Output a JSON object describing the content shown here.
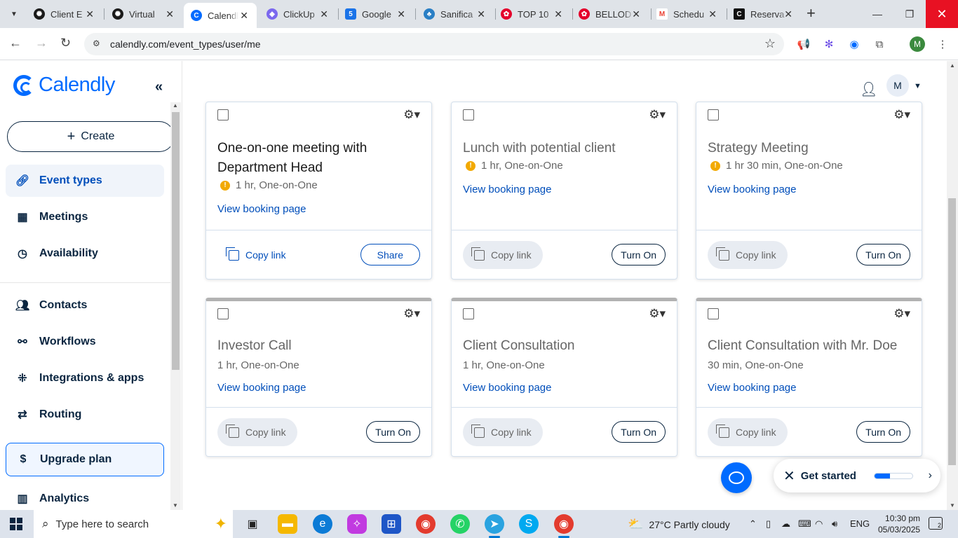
{
  "browser": {
    "tabs": [
      {
        "title": "Client E",
        "fav_color": "#1a1a1a"
      },
      {
        "title": "Virtual",
        "fav_color": "#1a1a1a"
      },
      {
        "title": "Calendly",
        "fav_color": "#006bff"
      },
      {
        "title": "ClickUp",
        "fav_color": "#7b68ee"
      },
      {
        "title": "Google",
        "fav_color": "#1a73e8"
      },
      {
        "title": "Sanifica",
        "fav_color": "#2a7fc5"
      },
      {
        "title": "TOP 10",
        "fav_color": "#e4002b"
      },
      {
        "title": "BELLOD",
        "fav_color": "#e4002b"
      },
      {
        "title": "Schedu",
        "fav_color": "#ea4335"
      },
      {
        "title": "Reserva",
        "fav_color": "#111111"
      }
    ],
    "url": "calendly.com/event_types/user/me",
    "profile_initial": "M"
  },
  "sidebar": {
    "logo_text": "Calendly",
    "create_label": "Create",
    "items": [
      {
        "label": "Event types",
        "icon": "link-icon"
      },
      {
        "label": "Meetings",
        "icon": "calendar-icon"
      },
      {
        "label": "Availability",
        "icon": "clock-icon"
      },
      {
        "label": "Contacts",
        "icon": "contacts-icon"
      },
      {
        "label": "Workflows",
        "icon": "workflow-icon"
      },
      {
        "label": "Integrations & apps",
        "icon": "apps-grid-icon"
      },
      {
        "label": "Routing",
        "icon": "routing-icon"
      },
      {
        "label": "Upgrade plan",
        "icon": "dollar-icon"
      },
      {
        "label": "Analytics",
        "icon": "analytics-icon"
      }
    ]
  },
  "header": {
    "avatar_initial": "M"
  },
  "cards": [
    {
      "title": "One-on-one meeting with Department Head",
      "meta": "1 hr, One-on-One",
      "warning": true,
      "link": "View booking page",
      "copy_label": "Copy link",
      "button_label": "Share",
      "enabled": true
    },
    {
      "title": "Lunch with potential client",
      "meta": "1 hr, One-on-One",
      "warning": true,
      "link": "View booking page",
      "copy_label": "Copy link",
      "button_label": "Turn On",
      "enabled": false
    },
    {
      "title": "Strategy Meeting",
      "meta": "1 hr 30 min, One-on-One",
      "warning": true,
      "link": "View booking page",
      "copy_label": "Copy link",
      "button_label": "Turn On",
      "enabled": false
    },
    {
      "title": "Investor Call",
      "meta": "1 hr, One-on-One",
      "warning": false,
      "link": "View booking page",
      "copy_label": "Copy link",
      "button_label": "Turn On",
      "enabled": false
    },
    {
      "title": "Client Consultation",
      "meta": "1 hr, One-on-One",
      "warning": false,
      "link": "View booking page",
      "copy_label": "Copy link",
      "button_label": "Turn On",
      "enabled": false
    },
    {
      "title": "Client Consultation with Mr. Doe",
      "meta": "30 min, One-on-One",
      "warning": false,
      "link": "View booking page",
      "copy_label": "Copy link",
      "button_label": "Turn On",
      "enabled": false
    }
  ],
  "get_started": {
    "label": "Get started",
    "progress": 0.4
  },
  "taskbar": {
    "search_placeholder": "Type here to search",
    "weather": "27°C  Partly cloudy",
    "language": "ENG",
    "time": "10:30 pm",
    "date": "05/03/2025",
    "notif_count": "2"
  },
  "colors": {
    "brand": "#006bff",
    "link": "#004eba",
    "navy": "#0a2540"
  }
}
